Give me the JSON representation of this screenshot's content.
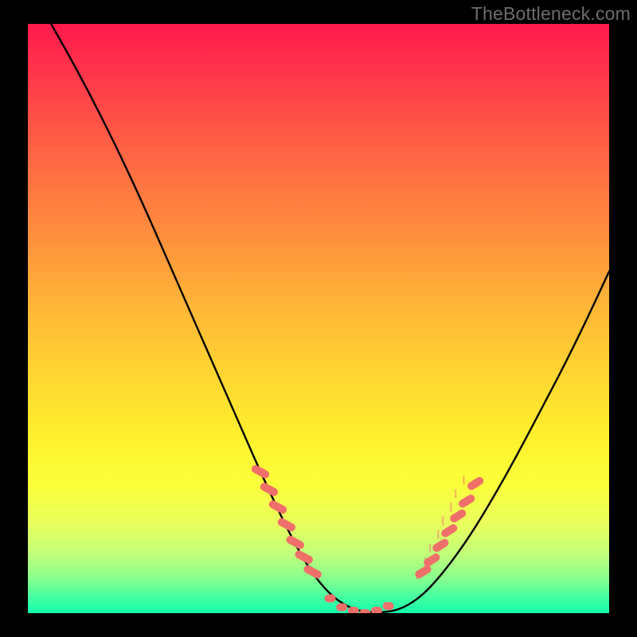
{
  "watermark": "TheBottleneck.com",
  "colors": {
    "background": "#000000",
    "curve": "#000000",
    "marker": "#ef6f6a",
    "gradient_top": "#ff1a4d",
    "gradient_bottom": "#12ffad"
  },
  "chart_data": {
    "type": "line",
    "title": "",
    "xlabel": "",
    "ylabel": "",
    "xlim": [
      0,
      100
    ],
    "ylim": [
      0,
      100
    ],
    "x": [
      4,
      8,
      12,
      16,
      20,
      24,
      28,
      32,
      36,
      40,
      44,
      48,
      52,
      56,
      60,
      64,
      68,
      72,
      76,
      80,
      84,
      88,
      92,
      96,
      100
    ],
    "values": [
      100,
      93,
      85.5,
      77.5,
      69,
      60,
      51,
      42,
      33,
      24,
      15.5,
      8,
      3,
      0.5,
      0,
      0.5,
      3,
      7.5,
      13,
      19.5,
      26.5,
      34,
      41.5,
      49.5,
      58
    ],
    "markers": {
      "left_cluster_x": [
        40,
        41.5,
        43,
        44.5,
        46,
        47.5,
        49
      ],
      "left_cluster_y": [
        24,
        21,
        18,
        15,
        12,
        9.5,
        7
      ],
      "valley_cluster_x": [
        52,
        54,
        56,
        58,
        60,
        62
      ],
      "valley_cluster_y": [
        2.5,
        1,
        0.4,
        0,
        0.4,
        1.2
      ],
      "right_cluster_x": [
        68,
        69.5,
        71,
        72.5,
        74,
        75.5,
        77
      ],
      "right_cluster_y": [
        7,
        9,
        11.5,
        14,
        16.5,
        19,
        22
      ]
    }
  }
}
